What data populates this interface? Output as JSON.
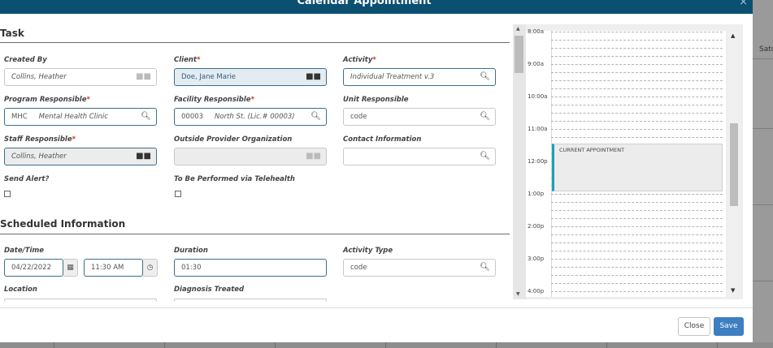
{
  "window": {
    "title": "Calendar Appointment",
    "close_glyph": "×"
  },
  "backdrop": {
    "day_label": "Satu"
  },
  "task": {
    "title": "Task",
    "created_by": {
      "label": "Created By",
      "value": "Collins, Heather"
    },
    "client": {
      "label": "Client",
      "value": "Doe, Jane Marie"
    },
    "activity": {
      "label": "Activity",
      "value": "Individual Treatment v.3"
    },
    "program_responsible": {
      "label": "Program Responsible",
      "code": "MHC",
      "value": "Mental Health Clinic"
    },
    "facility_responsible": {
      "label": "Facility Responsible",
      "code": "00003",
      "value": "North St. (Lic.# 00003)"
    },
    "unit_responsible": {
      "label": "Unit Responsible",
      "placeholder": "code"
    },
    "staff_responsible": {
      "label": "Staff Responsible",
      "value": "Collins, Heather"
    },
    "outside_provider": {
      "label": "Outside Provider Organization",
      "value": ""
    },
    "contact_information": {
      "label": "Contact Information",
      "value": ""
    },
    "send_alert": {
      "label": "Send Alert?",
      "checked": false
    },
    "telehealth": {
      "label": "To Be Performed via Telehealth",
      "checked": false
    }
  },
  "scheduled": {
    "title": "Scheduled Information",
    "datetime": {
      "label": "Date/Time",
      "date": "04/22/2022",
      "time": "11:30 AM"
    },
    "duration": {
      "label": "Duration",
      "value": "01:30"
    },
    "activity_type": {
      "label": "Activity Type",
      "placeholder": "code"
    },
    "location": {
      "label": "Location"
    },
    "diagnosis": {
      "label": "Diagnosis Treated"
    }
  },
  "calendar": {
    "times": [
      "8:00a",
      "9:00a",
      "10:00a",
      "11:00a",
      "12:00p",
      "1:00p",
      "2:00p",
      "3:00p",
      "4:00p"
    ],
    "appointment_label": "CURRENT APPOINTMENT"
  },
  "footer": {
    "close_label": "Close",
    "save_label": "Save"
  },
  "icons": {
    "binoculars": "⛽",
    "search": "⚲",
    "calendar": "▦",
    "clock": "◷"
  }
}
